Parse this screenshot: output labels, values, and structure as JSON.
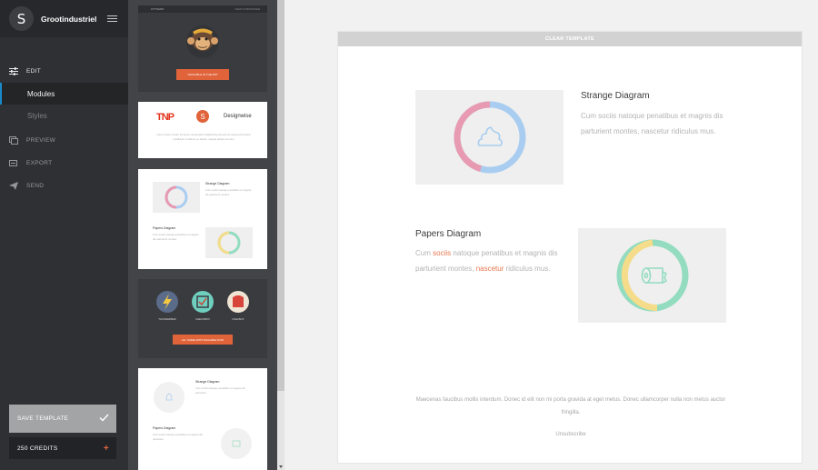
{
  "brand": {
    "initial": "S",
    "name": "Grootindustriel"
  },
  "nav": {
    "edit": "EDIT",
    "modules": "Modules",
    "styles": "Styles",
    "preview": "PREVIEW",
    "export": "EXPORT",
    "send": "SEND"
  },
  "buttons": {
    "save_template": "SAVE TEMPLATE",
    "credits": "250 CREDITS"
  },
  "thumbnails": {
    "t1": {
      "header_left": "OTTOMAT",
      "header_right": "VIEW IN BROWSER",
      "cta": "AVAILABLE IN THE APP"
    },
    "t2": {
      "logo_left": "TNP",
      "logo_mid": "S",
      "logo_right": "Designwise",
      "text": "Lorem ipsum dolor sit amet consectetur adipiscing elit sed do eiusmod tempor incididunt ut labore et dolore magna aliqua ut enim"
    },
    "t3": {
      "title1": "Strange Diagram",
      "title2": "Papers Diagram",
      "text": "Cum sociis natoque penatibus et magnis dis parturient montes"
    },
    "t4": {
      "label1": "THUNDERBAR",
      "label2": "CHECKBOX",
      "label3": "FUELBOX",
      "cta": "ALL THREE APPS AVAILABLE NOW"
    },
    "t5": {
      "title1": "Strange Diagram",
      "title2": "Papers Diagram",
      "text": "Cum sociis natoque penatibus et magnis dis parturient"
    }
  },
  "canvas": {
    "clear_label": "CLEAR TEMPLATE",
    "block1": {
      "title": "Strange Diagram",
      "text": "Cum sociis natoque penatibus et magnis dis parturient montes, nascetur ridiculus mus."
    },
    "block2": {
      "title": "Papers Diagram",
      "text_a": "Cum ",
      "link_a": "sociis",
      "text_b": " natoque penatibus et magnis dis parturient montes, ",
      "link_b": "nascetur",
      "text_c": " ridiculus mus."
    },
    "footer": "Maecenas faucibus mollis interdum. Donec id elit non mi porta gravida at eget metus. Donec ullamcorper nulla non metus auctor fringilla.",
    "unsubscribe": "Unsubscribe"
  },
  "colors": {
    "accent": "#e5673e",
    "ring_pink": "#e79ab1",
    "ring_blue": "#a9cdf0",
    "ring_yellow": "#f5dc8a",
    "ring_green": "#93dcc0"
  }
}
